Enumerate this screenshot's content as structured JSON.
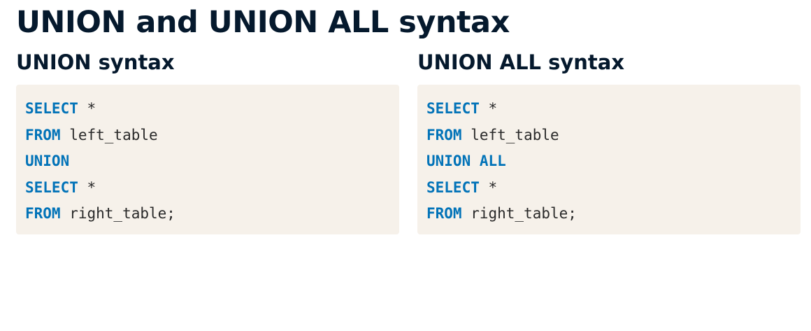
{
  "page": {
    "title": "UNION and UNION ALL syntax"
  },
  "union": {
    "heading": "UNION syntax",
    "code": [
      {
        "keyword": "SELECT",
        "rest": " *"
      },
      {
        "keyword": "FROM",
        "rest": " left_table"
      },
      {
        "keyword": "UNION",
        "rest": ""
      },
      {
        "keyword": "SELECT",
        "rest": " *"
      },
      {
        "keyword": "FROM",
        "rest": " right_table;"
      }
    ]
  },
  "union_all": {
    "heading": "UNION ALL syntax",
    "code": [
      {
        "keyword": "SELECT",
        "rest": " *"
      },
      {
        "keyword": "FROM",
        "rest": " left_table"
      },
      {
        "keyword": "UNION ALL",
        "rest": ""
      },
      {
        "keyword": "SELECT",
        "rest": " *"
      },
      {
        "keyword": "FROM",
        "rest": " right_table;"
      }
    ]
  },
  "colors": {
    "title": "#05192d",
    "keyword": "#0273b8",
    "code_text": "#2a2a2a",
    "code_background": "#f6f1ea"
  }
}
